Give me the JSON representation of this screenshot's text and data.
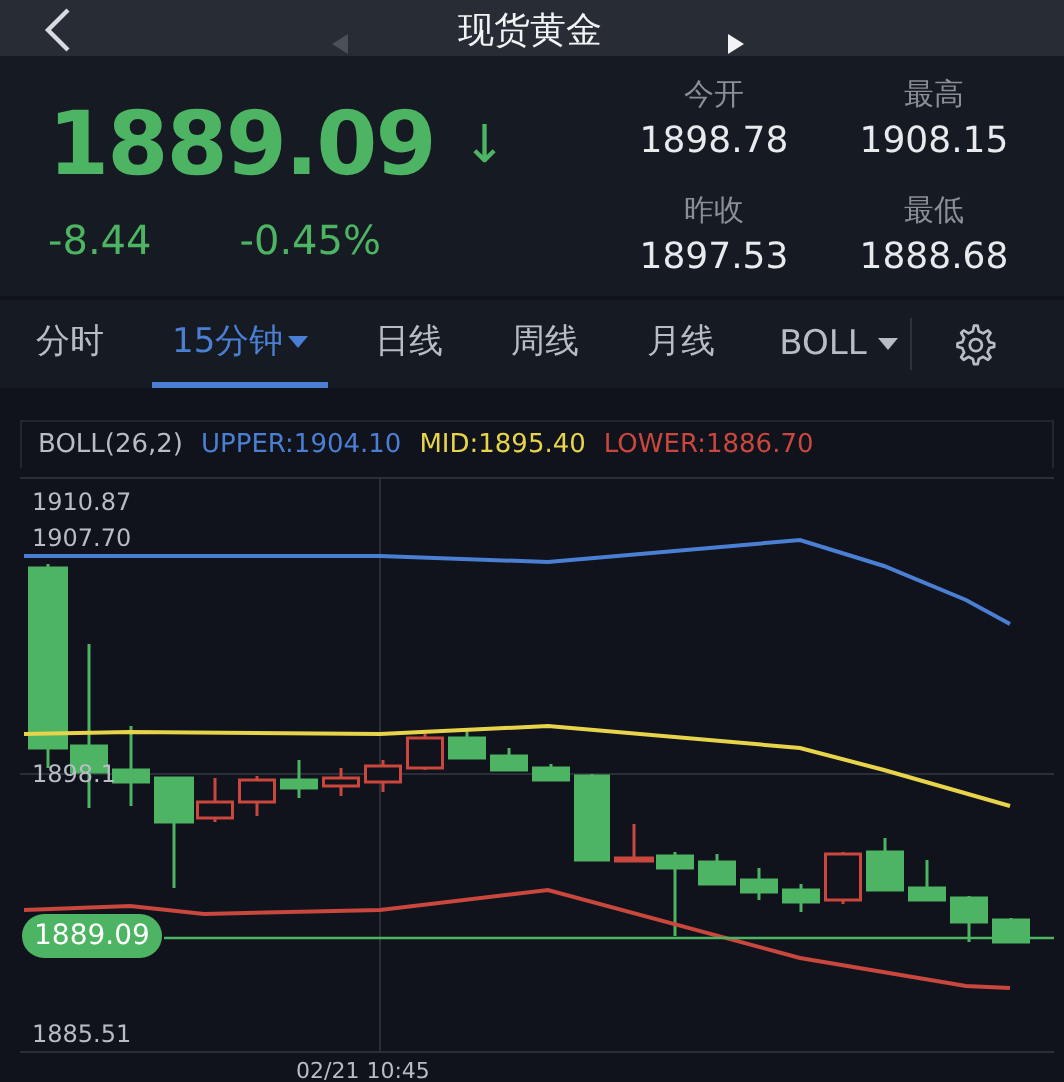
{
  "header": {
    "title": "现货黄金"
  },
  "quote": {
    "price": "1889.09",
    "arrow": "↓",
    "change": "-8.44",
    "change_pct": "-0.45%"
  },
  "stats": [
    {
      "label": "今开",
      "value": "1898.78"
    },
    {
      "label": "最高",
      "value": "1908.15"
    },
    {
      "label": "昨收",
      "value": "1897.53"
    },
    {
      "label": "最低",
      "value": "1888.68"
    }
  ],
  "tabs": [
    {
      "label": "分时",
      "selected": false,
      "dropdown": false
    },
    {
      "label": "15分钟",
      "selected": true,
      "dropdown": true
    },
    {
      "label": "日线",
      "selected": false,
      "dropdown": false
    },
    {
      "label": "周线",
      "selected": false,
      "dropdown": false
    },
    {
      "label": "月线",
      "selected": false,
      "dropdown": false
    }
  ],
  "indicator_menu": {
    "label": "BOLL"
  },
  "legend": {
    "name": "BOLL(26,2)",
    "items": [
      {
        "text": "UPPER:1904.10",
        "color": "#4a7fd4"
      },
      {
        "text": "MID:1895.40",
        "color": "#e8d44a"
      },
      {
        "text": "LOWER:1886.70",
        "color": "#c9473d"
      }
    ]
  },
  "chart": {
    "y_labels": [
      "1910.87",
      "1907.70",
      "1898.1",
      "1885.51"
    ],
    "date_label": "02/21 10:45",
    "last_price": "1889.09"
  }
}
